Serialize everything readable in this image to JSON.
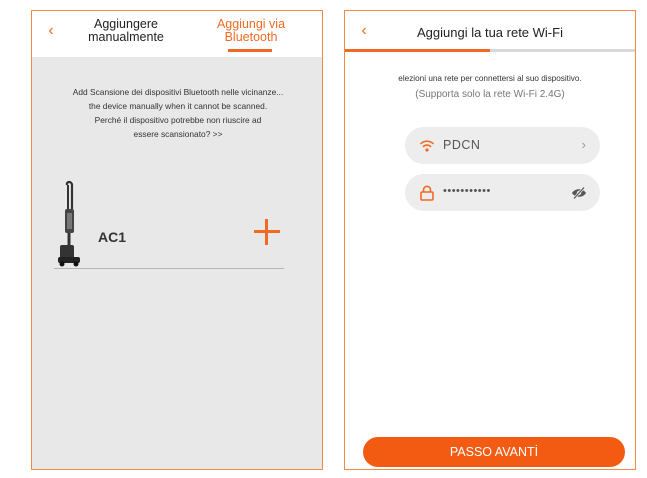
{
  "bluetooth_screen": {
    "back_icon": "chevron-left-icon",
    "tabs": {
      "manual_line1": "Aggiungere",
      "manual_line2": "manualmente",
      "bluetooth_line1": "Aggiungi via",
      "bluetooth_line2": "Bluetooth"
    },
    "info": {
      "line1": "Add Scansione dei dispositivi Bluetooth nelle vicinanze...",
      "line2": "the device manually when it cannot be scanned.",
      "line3": "Perché il dispositivo potrebbe non riuscire ad",
      "line4": "essere scansionato? >>"
    },
    "device": {
      "name": "AC1",
      "image_icon": "stick-vacuum-icon",
      "add_icon": "plus-icon"
    }
  },
  "wifi_screen": {
    "back_icon": "chevron-left-icon",
    "title": "Aggiungi la tua rete Wi-Fi",
    "progress": 0.5,
    "prompt": "elezioni una rete per connettersi al suo dispositivo.",
    "note": "(Supporta solo la rete Wi-Fi 2.4G)",
    "ssid": "PDCN",
    "ssid_icon": "wifi-icon",
    "ssid_chevron_icon": "chevron-right-icon",
    "password_masked": "•••••••••••",
    "password_icon": "lock-icon",
    "visibility_icon": "eye-slash-icon",
    "next_button": "PASSO AVANTİ"
  },
  "colors": {
    "accent": "#f06a23",
    "button": "#f35b12",
    "border": "#f08a45",
    "panel_bg": "#e8e8e8",
    "field_bg": "#ededed"
  }
}
